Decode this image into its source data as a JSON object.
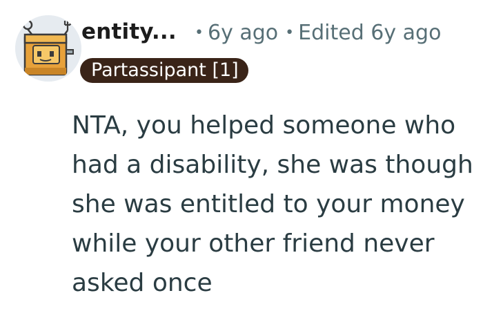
{
  "comment": {
    "author": "entity...",
    "age": "6y ago",
    "edited": "Edited 6y ago",
    "flair": "Partassipant [1]",
    "body": "NTA, you helped someone who had a disability, she was though she was entitled to your money while your other friend never asked once",
    "avatar_icon": "robot-toaster-avatar-icon"
  },
  "colors": {
    "flair_bg": "#3a2418",
    "meta_text": "#576f76",
    "body_text": "#2a3c42"
  }
}
